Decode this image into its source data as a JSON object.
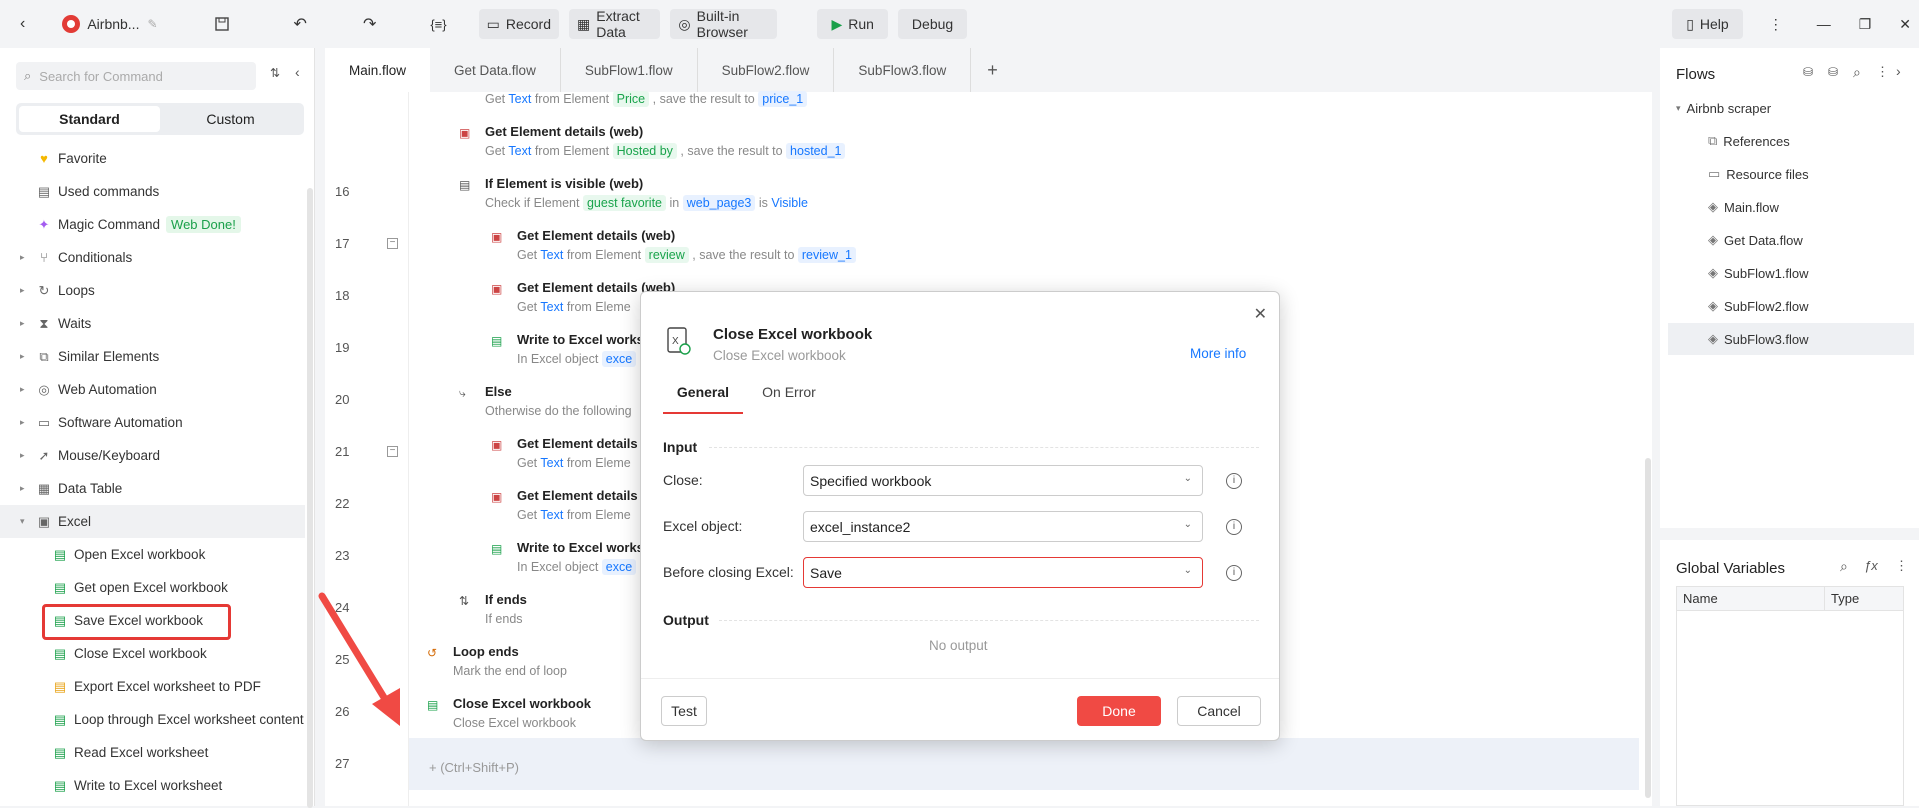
{
  "topbar": {
    "app_name": "Airbnb...",
    "record": "Record",
    "extract": "Extract Data",
    "browser": "Built-in Browser",
    "run": "Run",
    "debug": "Debug",
    "help": "Help"
  },
  "sidebar": {
    "search_placeholder": "Search for Command",
    "tab_standard": "Standard",
    "tab_custom": "Custom",
    "items": [
      {
        "label": "Favorite",
        "icon": "heart-icon"
      },
      {
        "label": "Used commands",
        "icon": "calendar-icon"
      },
      {
        "label": "Magic Command",
        "icon": "sparkle-icon",
        "badge": "Web Done!"
      },
      {
        "label": "Conditionals",
        "icon": "branch-icon"
      },
      {
        "label": "Loops",
        "icon": "loop-icon"
      },
      {
        "label": "Waits",
        "icon": "hourglass-icon"
      },
      {
        "label": "Similar Elements",
        "icon": "copy-icon"
      },
      {
        "label": "Web Automation",
        "icon": "globe-icon"
      },
      {
        "label": "Software Automation",
        "icon": "monitor-icon"
      },
      {
        "label": "Mouse/Keyboard",
        "icon": "cursor-icon"
      },
      {
        "label": "Data Table",
        "icon": "table-icon"
      },
      {
        "label": "Excel",
        "icon": "excel-icon"
      }
    ],
    "excel_items": [
      "Open Excel workbook",
      "Get open Excel workbook",
      "Save Excel workbook",
      "Close Excel workbook",
      "Export Excel worksheet to PDF",
      "Loop through Excel worksheet content",
      "Read Excel worksheet",
      "Write to Excel worksheet"
    ]
  },
  "editor": {
    "tabs": [
      "Main.flow",
      "Get Data.flow",
      "SubFlow1.flow",
      "SubFlow2.flow",
      "SubFlow3.flow"
    ],
    "add_tab": "+",
    "line_numbers": [
      "16",
      "17",
      "18",
      "19",
      "20",
      "21",
      "22",
      "23",
      "24",
      "25",
      "26",
      "27"
    ],
    "w_get": "Get",
    "w_text": "Text",
    "w_from": "from Element",
    "w_save": ", save the result to",
    "price_el": "Price",
    "price_var": "price_1",
    "s16_title": "Get Element details (web)",
    "s16_el": "Hosted by",
    "s16_var": "hosted_1",
    "s17_title": "If Element is visible (web)",
    "s17_check": "Check if Element",
    "s17_el": "guest favorite",
    "s17_in": "in",
    "s17_page": "web_page3",
    "s17_is": "is",
    "s17_state": "Visible",
    "s18_title": "Get Element details (web)",
    "s18_el": "review",
    "s18_var": "review_1",
    "s19_title": "Get Element details (web)",
    "s19_from": "from Eleme",
    "s20_title": "Write to Excel works",
    "s20_desc": "In Excel object",
    "s20_var": "exce",
    "s21_title": "Else",
    "s21_desc": "Otherwise do the following",
    "s22_title": "Get Element details",
    "s22_from": "from Eleme",
    "s23_title": "Get Element details",
    "s23_from": "from Eleme",
    "s24_title": "Write to Excel works",
    "s24_desc": "In Excel object",
    "s24_var": "exce",
    "s25_title": "If ends",
    "s25_desc": "If ends",
    "s26_title": "Loop ends",
    "s26_desc": "Mark the end of loop",
    "s27_title": "Close Excel workbook",
    "s27_desc": "Close Excel workbook",
    "add_hint": "(Ctrl+Shift+P)"
  },
  "flows": {
    "title": "Flows",
    "project": "Airbnb scraper",
    "items": [
      "References",
      "Resource files",
      "Main.flow",
      "Get Data.flow",
      "SubFlow1.flow",
      "SubFlow2.flow",
      "SubFlow3.flow"
    ]
  },
  "globals": {
    "title": "Global Variables",
    "col_name": "Name",
    "col_type": "Type"
  },
  "dialog": {
    "title": "Close Excel workbook",
    "subtitle": "Close Excel workbook",
    "more_info": "More info",
    "tab_general": "General",
    "tab_error": "On Error",
    "input_section": "Input",
    "close_label": "Close:",
    "close_value": "Specified workbook",
    "excel_label": "Excel object:",
    "excel_value": "excel_instance2",
    "before_label": "Before closing Excel:",
    "before_value": "Save",
    "output_section": "Output",
    "no_output": "No output",
    "test": "Test",
    "done": "Done",
    "cancel": "Cancel"
  },
  "colors": {
    "accent_red": "#f04a44",
    "link_blue": "#1677ff",
    "annotation_red": "#e53935"
  }
}
